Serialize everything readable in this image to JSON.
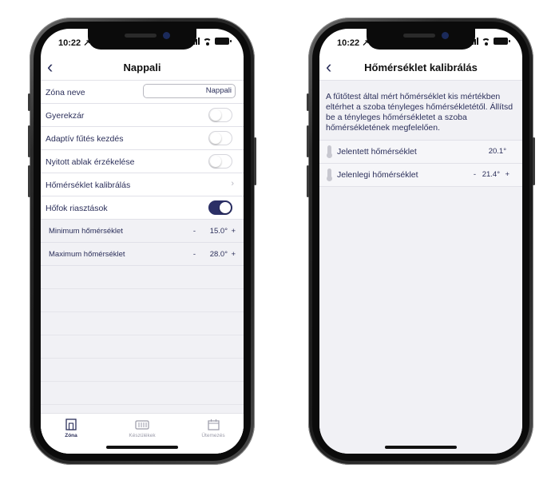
{
  "left_phone": {
    "status": {
      "time": "10:22 ↗"
    },
    "nav": {
      "back": "‹",
      "title": "Nappali"
    },
    "rows": [
      {
        "label": "Zóna neve",
        "value": "Nappali"
      },
      {
        "label": "Gyerekzár",
        "toggle": "off"
      },
      {
        "label": "Adaptív fűtés kezdés",
        "toggle": "off"
      },
      {
        "label": "Nyitott ablak érzékelése",
        "toggle": "off"
      },
      {
        "label": "Hőmérséklet kalibrálás",
        "chevron": "›"
      },
      {
        "label": "Hőfok riasztások",
        "toggle": "on"
      }
    ],
    "sub_rows": [
      {
        "label": "Minimum hőmérséklet",
        "minus": "-",
        "value": "15.0°",
        "plus": "+"
      },
      {
        "label": "Maximum hőmérséklet",
        "minus": "-",
        "value": "28.0°",
        "plus": "+"
      }
    ],
    "tabs": [
      {
        "label": "Zóna",
        "icon": "zone-icon",
        "active": true
      },
      {
        "label": "Készülékek",
        "icon": "devices-icon",
        "active": false
      },
      {
        "label": "Ütemezés",
        "icon": "calendar-icon",
        "active": false
      }
    ]
  },
  "right_phone": {
    "status": {
      "time": "10:22 ↗"
    },
    "nav": {
      "back": "‹",
      "title": "Hőmérséklet kalibrálás"
    },
    "description": "A fűtőtest által mért hőmérséklet kis mértékben eltérhet a szoba tényleges hőmérsékletétől. Állítsd be a tényleges hőmérsékletet a szoba hőmérsékletének megfelelően.",
    "rows": [
      {
        "label": "Jelentett hőmérséklet",
        "value": "20.1°"
      },
      {
        "label": "Jelenlegi hőmérséklet",
        "minus": "-",
        "value": "21.4°",
        "plus": "+"
      }
    ]
  },
  "colors": {
    "accent": "#2b2f66",
    "text": "#2b2f5a",
    "background": "#f1f1f5"
  }
}
